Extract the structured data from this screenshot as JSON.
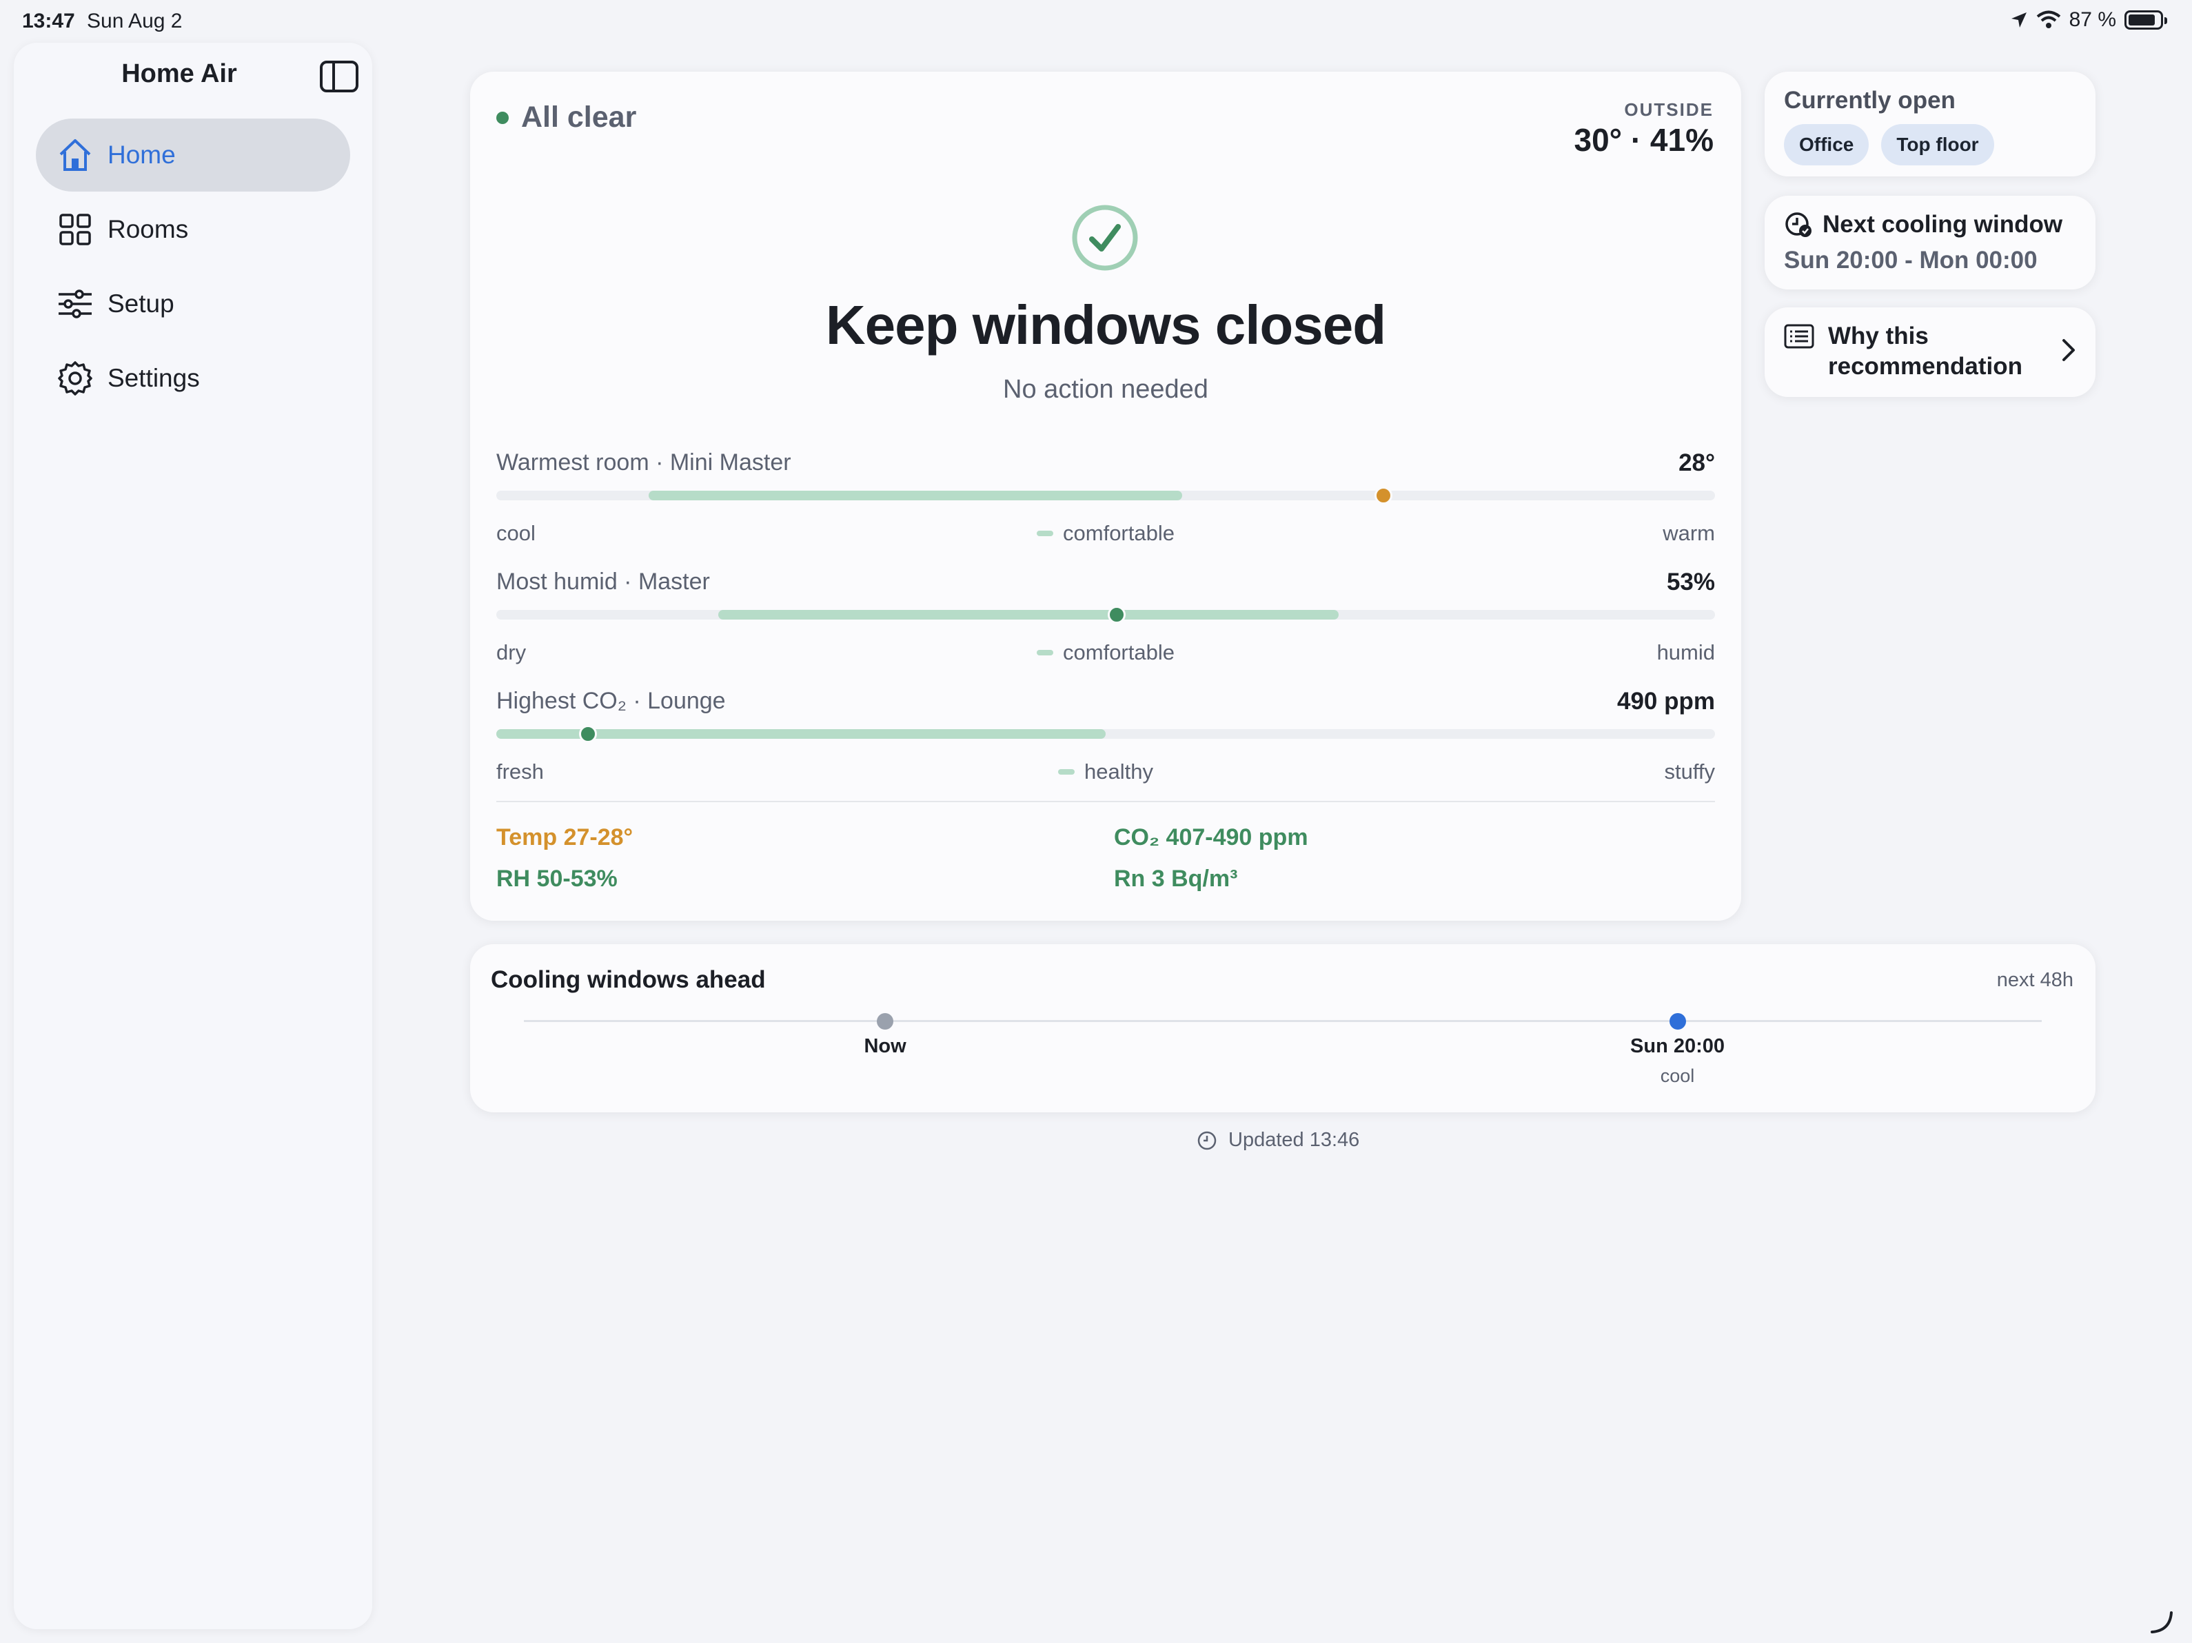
{
  "status_bar": {
    "time": "13:47",
    "date": "Sun Aug 2",
    "battery": "87 %",
    "battery_level": 0.87
  },
  "sidebar": {
    "title": "Home Air",
    "items": [
      {
        "label": "Home",
        "icon": "house-icon",
        "active": true
      },
      {
        "label": "Rooms",
        "icon": "grid-icon",
        "active": false
      },
      {
        "label": "Setup",
        "icon": "sliders-icon",
        "active": false
      },
      {
        "label": "Settings",
        "icon": "gear-icon",
        "active": false
      }
    ]
  },
  "main": {
    "status": "All clear",
    "outside_label": "OUTSIDE",
    "outside_value": "30° · 41%",
    "headline": "Keep windows closed",
    "subline": "No action needed",
    "metrics": [
      {
        "label": "Warmest room · Mini Master",
        "value": "28°",
        "left": "cool",
        "mid": "comfortable",
        "right": "warm",
        "range_start": 0.125,
        "range_end": 0.563,
        "marker": 0.728,
        "marker_color": "#d4912c"
      },
      {
        "label": "Most humid · Master",
        "value": "53%",
        "left": "dry",
        "mid": "comfortable",
        "right": "humid",
        "range_start": 0.182,
        "range_end": 0.691,
        "marker": 0.509,
        "marker_color": "#3f8c5f"
      },
      {
        "label": "Highest CO₂ · Lounge",
        "value": "490 ppm",
        "left": "fresh",
        "mid": "healthy",
        "right": "stuffy",
        "range_start": 0.0,
        "range_end": 0.5,
        "marker": 0.075,
        "marker_color": "#3f8c5f"
      }
    ],
    "summary": [
      {
        "text": "Temp 27-28°",
        "color": "#d4912c"
      },
      {
        "text": "CO₂ 407-490 ppm",
        "color": "#3f8c5f"
      },
      {
        "text": "RH 50-53%",
        "color": "#3f8c5f"
      },
      {
        "text": "Rn 3 Bq/m³",
        "color": "#3f8c5f"
      }
    ]
  },
  "currently_open": {
    "title": "Currently open",
    "rooms": [
      "Office",
      "Top floor"
    ]
  },
  "next_cooling": {
    "title": "Next cooling window",
    "time": "Sun 20:00 - Mon 00:00"
  },
  "why": {
    "line1": "Why this",
    "line2": "recommendation"
  },
  "timeline": {
    "title": "Cooling windows ahead",
    "range": "next 48h",
    "points": [
      {
        "label": "Now",
        "sub": "",
        "pos": 0.238,
        "color": "#9aa1ad"
      },
      {
        "label": "Sun 20:00",
        "sub": "cool",
        "pos": 0.76,
        "color": "#2f6fd9"
      }
    ]
  },
  "updated": "Updated 13:46",
  "colors": {
    "accent": "#2f6fd9",
    "good": "#3f8c5f",
    "warn": "#d4912c",
    "range": "#b6dcc8"
  }
}
